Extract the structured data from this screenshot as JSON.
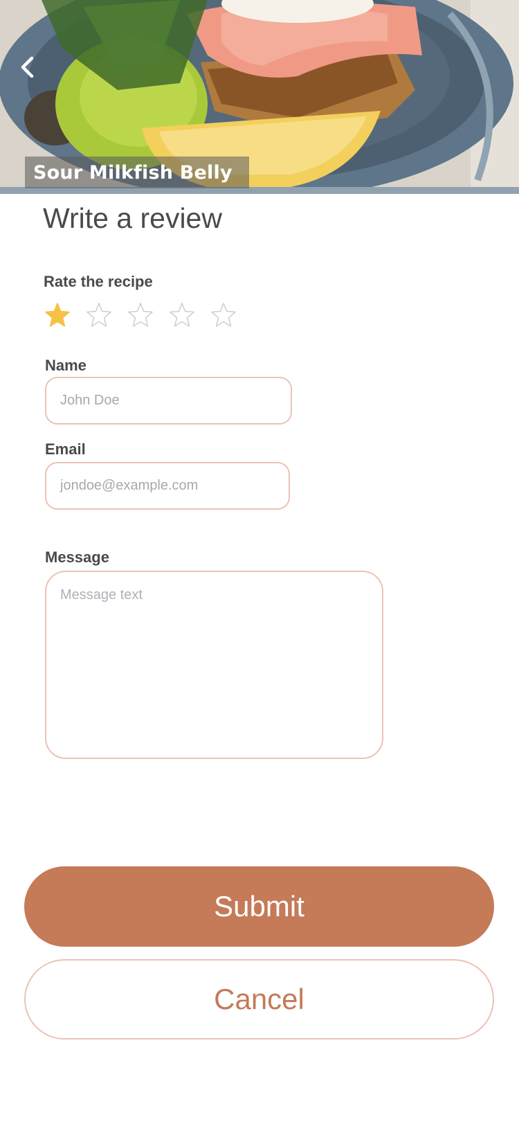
{
  "hero": {
    "recipe_title": "Sour Milkfish Belly",
    "back_icon": "chevron-left-icon"
  },
  "form": {
    "heading": "Write a review",
    "rating": {
      "label": "Rate the recipe",
      "value": 1,
      "max": 5,
      "filled_color": "#f6c244",
      "empty_color": "#cfcfcf"
    },
    "name": {
      "label": "Name",
      "placeholder": "John Doe",
      "value": ""
    },
    "email": {
      "label": "Email",
      "placeholder": "jondoe@example.com",
      "value": ""
    },
    "message": {
      "label": "Message",
      "placeholder": "Message text",
      "value": ""
    }
  },
  "actions": {
    "submit_label": "Submit",
    "cancel_label": "Cancel"
  },
  "colors": {
    "accent": "#c57a58",
    "field_border": "#ebc3b3"
  }
}
